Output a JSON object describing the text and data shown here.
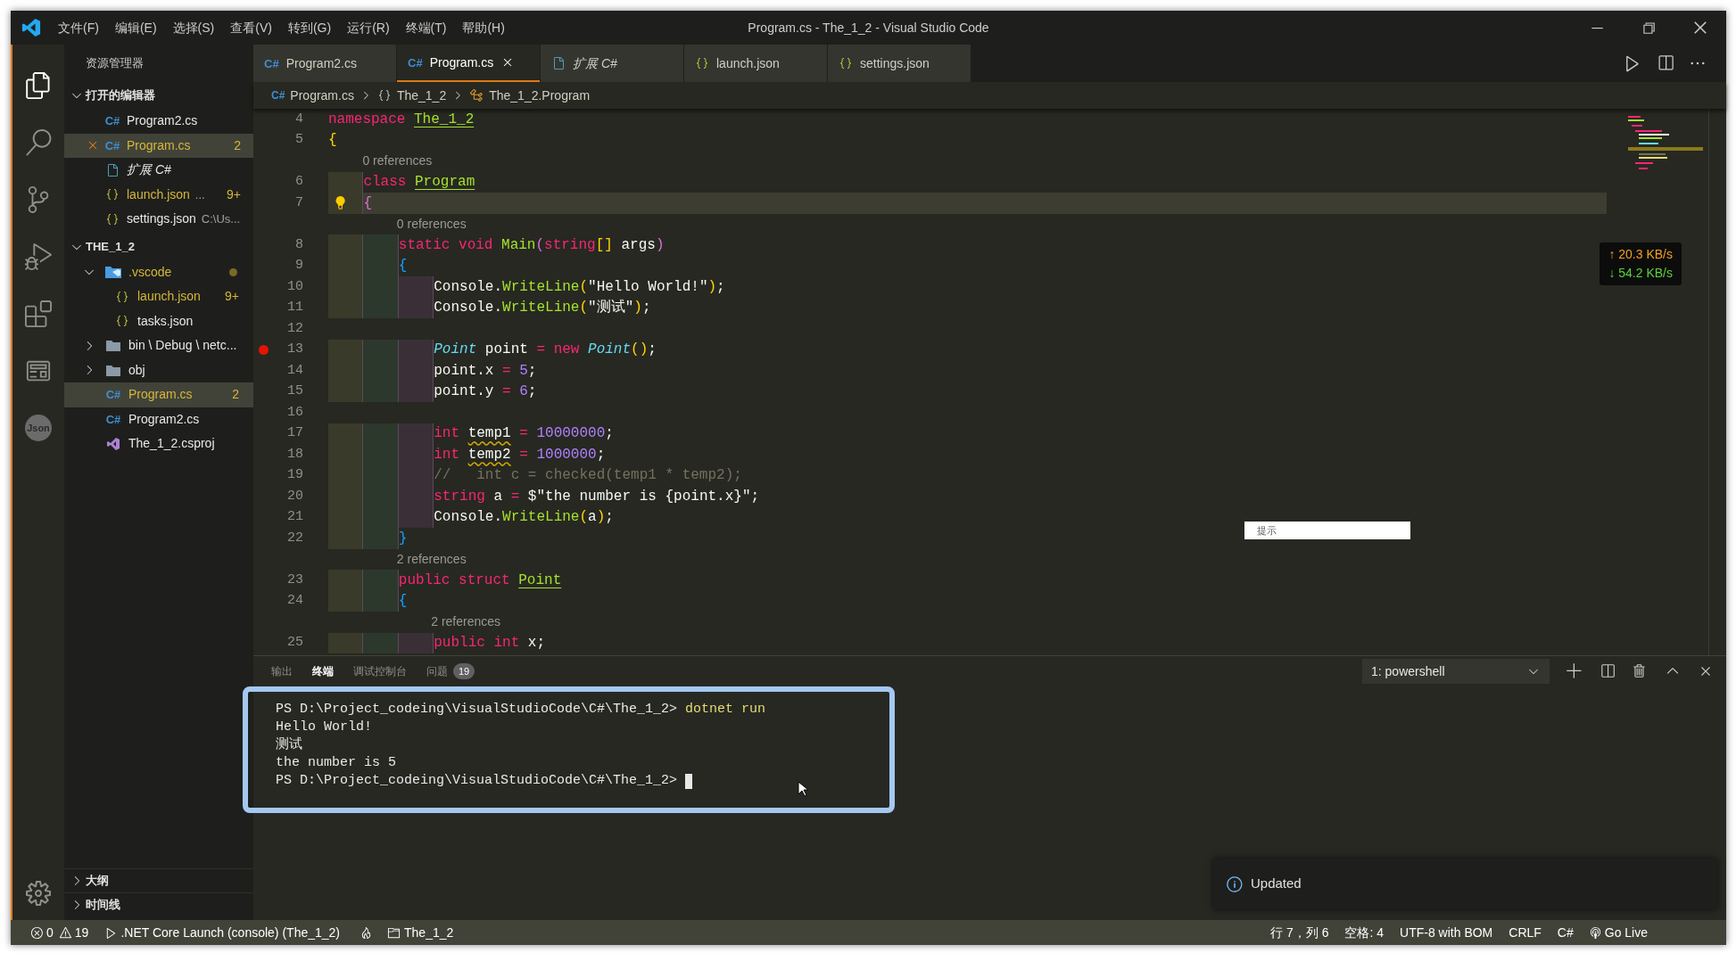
{
  "window": {
    "title": "Program.cs - The_1_2 - Visual Studio Code"
  },
  "menu": [
    "文件(F)",
    "编辑(E)",
    "选择(S)",
    "查看(V)",
    "转到(G)",
    "运行(R)",
    "终端(T)",
    "帮助(H)"
  ],
  "activity_bar": {
    "items": [
      {
        "kind": "explorer",
        "selected": true
      },
      {
        "kind": "search",
        "selected": false
      },
      {
        "kind": "source-control",
        "selected": false
      },
      {
        "kind": "run",
        "selected": false
      },
      {
        "kind": "extensions",
        "selected": false
      },
      {
        "kind": "preview",
        "selected": false
      },
      {
        "kind": "json",
        "label": "Json",
        "selected": false
      }
    ],
    "bottom": [
      {
        "kind": "settings"
      }
    ]
  },
  "sidebar": {
    "title": "资源管理器",
    "open_editors": {
      "label": "打开的编辑器",
      "expanded": true,
      "items": [
        {
          "kind": "cs",
          "icon_text": "C#",
          "name": "Program2.cs",
          "selected": false,
          "warning": false
        },
        {
          "kind": "cs",
          "icon_text": "C#",
          "name": "Program.cs",
          "badge": "2",
          "selected": true,
          "warning": true
        },
        {
          "kind": "file",
          "name": "扩展 C#",
          "preview": true,
          "selected": false,
          "warning": false
        },
        {
          "kind": "json",
          "name": "launch.json",
          "description": "...",
          "badge": "9+",
          "selected": false,
          "warning": true
        },
        {
          "kind": "json",
          "name": "settings.json",
          "description": "C:\\Us...",
          "selected": false,
          "warning": false
        }
      ]
    },
    "folder": {
      "label": "THE_1_2",
      "expanded": true,
      "children": [
        {
          "kind": "vscode-folder",
          "name": ".vscode",
          "expanded": true,
          "problems_dot": true,
          "selected": false,
          "warning": true,
          "children": [
            {
              "kind": "json",
              "name": "launch.json",
              "badge": "9+",
              "selected": false,
              "warning": true
            },
            {
              "kind": "json",
              "name": "tasks.json",
              "selected": false,
              "warning": false
            }
          ]
        },
        {
          "kind": "folder",
          "name": "bin \\ Debug \\ netc...",
          "expanded": false,
          "selected": false,
          "warning": false
        },
        {
          "kind": "folder",
          "name": "obj",
          "expanded": false,
          "selected": false,
          "warning": false
        },
        {
          "kind": "cs",
          "icon_text": "C#",
          "name": "Program.cs",
          "badge": "2",
          "selected": true,
          "warning": true
        },
        {
          "kind": "cs",
          "icon_text": "C#",
          "name": "Program2.cs",
          "selected": false,
          "warning": false
        },
        {
          "kind": "csproj",
          "name": "The_1_2.csproj",
          "selected": false,
          "warning": false
        }
      ]
    },
    "bottom_sections": [
      {
        "label": "大纲",
        "expanded": false
      },
      {
        "label": "时间线",
        "expanded": false
      }
    ]
  },
  "tabs": [
    {
      "kind": "cs",
      "icon_text": "C#",
      "label": "Program2.cs",
      "selected": false,
      "preview": false
    },
    {
      "kind": "cs",
      "icon_text": "C#",
      "label": "Program.cs",
      "selected": true,
      "preview": false
    },
    {
      "kind": "file",
      "label": "扩展 C#",
      "selected": false,
      "preview": true
    },
    {
      "kind": "json",
      "label": "launch.json",
      "selected": false,
      "preview": false
    },
    {
      "kind": "json",
      "label": "settings.json",
      "selected": false,
      "preview": false
    }
  ],
  "breadcrumb": [
    {
      "kind": "cs",
      "icon_text": "C#",
      "label": "Program.cs"
    },
    {
      "kind": "namespace",
      "label": "The_1_2"
    },
    {
      "kind": "class",
      "label": "The_1_2.Program"
    }
  ],
  "code": [
    {
      "kind": "code",
      "number": "4",
      "tokens": [
        {
          "text": "namespace ",
          "kind": "keyword"
        },
        {
          "text": "The_1_2",
          "kind": "class"
        }
      ]
    },
    {
      "kind": "code",
      "number": "5",
      "tokens": [
        {
          "text": "{",
          "kind": "bracket1"
        }
      ]
    },
    {
      "kind": "lens",
      "text": "0 references"
    },
    {
      "kind": "code",
      "number": "6",
      "tokens": [
        {
          "text": "    class ",
          "kind": "keyword"
        },
        {
          "text": "Program",
          "kind": "class"
        }
      ]
    },
    {
      "kind": "code",
      "number": "7",
      "current": true,
      "bulb": true,
      "tokens": [
        {
          "text": "    {",
          "kind": "bracket2"
        }
      ]
    },
    {
      "kind": "lens",
      "text": "0 references"
    },
    {
      "kind": "code",
      "number": "8",
      "tokens": [
        {
          "text": "        static void ",
          "kind": "keyword"
        },
        {
          "text": "Main",
          "kind": "function"
        },
        {
          "text": "(",
          "kind": "bracket2"
        },
        {
          "text": "string",
          "kind": "keyword"
        },
        {
          "text": "[]",
          "kind": "bracket1"
        },
        {
          "text": " args",
          "kind": "plain"
        },
        {
          "text": ")",
          "kind": "bracket2"
        }
      ]
    },
    {
      "kind": "code",
      "number": "9",
      "tokens": [
        {
          "text": "        {",
          "kind": "bracket3"
        }
      ]
    },
    {
      "kind": "code",
      "number": "10",
      "tokens": [
        {
          "text": "            Console.",
          "kind": "plain"
        },
        {
          "text": "WriteLine",
          "kind": "function"
        },
        {
          "text": "(",
          "kind": "bracket1"
        },
        {
          "text": "\"Hello World!\"",
          "kind": "plain"
        },
        {
          "text": ")",
          "kind": "bracket1"
        },
        {
          "text": ";",
          "kind": "plain"
        }
      ]
    },
    {
      "kind": "code",
      "number": "11",
      "tokens": [
        {
          "text": "            Console.",
          "kind": "plain"
        },
        {
          "text": "WriteLine",
          "kind": "function"
        },
        {
          "text": "(",
          "kind": "bracket1"
        },
        {
          "text": "\"测试\"",
          "kind": "plain"
        },
        {
          "text": ")",
          "kind": "bracket1"
        },
        {
          "text": ";",
          "kind": "plain"
        }
      ]
    },
    {
      "kind": "code",
      "number": "12"
    },
    {
      "kind": "code",
      "number": "13",
      "breakpoint": true,
      "tokens": [
        {
          "text": "            Point",
          "kind": "type"
        },
        {
          "text": " point ",
          "kind": "plain"
        },
        {
          "text": "= ",
          "kind": "keyword"
        },
        {
          "text": "new ",
          "kind": "keyword"
        },
        {
          "text": "Point",
          "kind": "type"
        },
        {
          "text": "()",
          "kind": "bracket1"
        },
        {
          "text": ";",
          "kind": "plain"
        }
      ]
    },
    {
      "kind": "code",
      "number": "14",
      "tokens": [
        {
          "text": "            point.x ",
          "kind": "plain"
        },
        {
          "text": "= ",
          "kind": "keyword"
        },
        {
          "text": "5",
          "kind": "number"
        },
        {
          "text": ";",
          "kind": "plain"
        }
      ]
    },
    {
      "kind": "code",
      "number": "15",
      "tokens": [
        {
          "text": "            point.y ",
          "kind": "plain"
        },
        {
          "text": "= ",
          "kind": "keyword"
        },
        {
          "text": "6",
          "kind": "number"
        },
        {
          "text": ";",
          "kind": "plain"
        }
      ]
    },
    {
      "kind": "code",
      "number": "16"
    },
    {
      "kind": "code",
      "number": "17",
      "tokens": [
        {
          "text": "            int ",
          "kind": "keyword"
        },
        {
          "text": "temp1",
          "kind": "plain",
          "warning": true
        },
        {
          "text": " = ",
          "kind": "keyword"
        },
        {
          "text": "10000000",
          "kind": "number"
        },
        {
          "text": ";",
          "kind": "plain"
        }
      ]
    },
    {
      "kind": "code",
      "number": "18",
      "tokens": [
        {
          "text": "            int ",
          "kind": "keyword"
        },
        {
          "text": "temp2",
          "kind": "plain",
          "warning": true
        },
        {
          "text": " = ",
          "kind": "keyword"
        },
        {
          "text": "1000000",
          "kind": "number"
        },
        {
          "text": ";",
          "kind": "plain"
        }
      ]
    },
    {
      "kind": "code",
      "number": "19",
      "tokens": [
        {
          "text": "            //   int c = checked(temp1 * temp2);",
          "kind": "comment"
        }
      ]
    },
    {
      "kind": "code",
      "number": "20",
      "tokens": [
        {
          "text": "            string ",
          "kind": "keyword"
        },
        {
          "text": "a ",
          "kind": "plain"
        },
        {
          "text": "= ",
          "kind": "keyword"
        },
        {
          "text": "$\"the number is {point.x}\"",
          "kind": "plain"
        },
        {
          "text": ";",
          "kind": "plain"
        }
      ]
    },
    {
      "kind": "code",
      "number": "21",
      "tokens": [
        {
          "text": "            Console.",
          "kind": "plain"
        },
        {
          "text": "WriteLine",
          "kind": "function"
        },
        {
          "text": "(",
          "kind": "bracket1"
        },
        {
          "text": "a",
          "kind": "plain"
        },
        {
          "text": ")",
          "kind": "bracket1"
        },
        {
          "text": ";",
          "kind": "plain"
        }
      ]
    },
    {
      "kind": "code",
      "number": "22",
      "tokens": [
        {
          "text": "        }",
          "kind": "bracket3"
        }
      ]
    },
    {
      "kind": "lens",
      "text": "2 references"
    },
    {
      "kind": "code",
      "number": "23",
      "tokens": [
        {
          "text": "        public struct ",
          "kind": "keyword"
        },
        {
          "text": "Point",
          "kind": "class"
        }
      ]
    },
    {
      "kind": "code",
      "number": "24",
      "tokens": [
        {
          "text": "        {",
          "kind": "bracket3"
        }
      ]
    },
    {
      "kind": "lens",
      "text": "2 references"
    },
    {
      "kind": "code",
      "number": "25",
      "tokens": [
        {
          "text": "            public int ",
          "kind": "keyword"
        },
        {
          "text": "x;",
          "kind": "plain"
        }
      ]
    }
  ],
  "hint_popup": {
    "text": "提示"
  },
  "network_monitor": {
    "upload": "↑ 20.3 KB/s",
    "download": "↓ 54.2 KB/s"
  },
  "panel": {
    "tabs": [
      {
        "label": "输出",
        "selected": false
      },
      {
        "label": "终端",
        "selected": true
      },
      {
        "label": "调试控制台",
        "selected": false
      },
      {
        "label": "问题",
        "badge": "19",
        "selected": false
      }
    ],
    "terminal_select": {
      "value": "1: powershell"
    },
    "terminal": [
      {
        "kind": "command",
        "prompt": "PS D:\\Project_codeing\\VisualStudioCode\\C#\\The_1_2>",
        "command": "dotnet run"
      },
      {
        "kind": "output",
        "text": "Hello World!"
      },
      {
        "kind": "output",
        "text": "测试"
      },
      {
        "kind": "output",
        "text": "the number is 5"
      },
      {
        "kind": "prompt",
        "prompt": "PS D:\\Project_codeing\\VisualStudioCode\\C#\\The_1_2>"
      }
    ]
  },
  "notification": {
    "text": "Updated"
  },
  "status_bar": {
    "left": [
      {
        "kind": "problems",
        "errors": "0",
        "warnings": "19"
      },
      {
        "kind": "launch",
        "label": ".NET Core Launch (console) (The_1_2)"
      },
      {
        "kind": "flame"
      },
      {
        "kind": "folder",
        "label": "The_1_2"
      }
    ],
    "right": [
      {
        "kind": "text",
        "label": "行 7，列 6"
      },
      {
        "kind": "text",
        "label": "空格: 4"
      },
      {
        "kind": "text",
        "label": "UTF-8 with BOM"
      },
      {
        "kind": "text",
        "label": "CRLF"
      },
      {
        "kind": "text",
        "label": "C#"
      },
      {
        "kind": "golive",
        "label": "Go Live"
      }
    ]
  }
}
